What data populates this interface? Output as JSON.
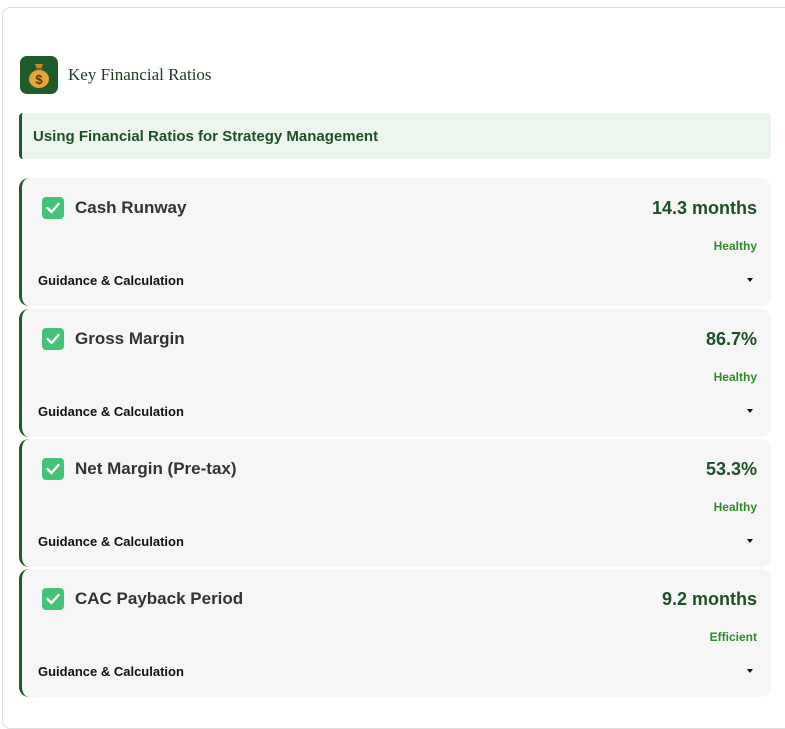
{
  "header": {
    "title": "Key Financial Ratios",
    "icon": "money-bag-icon"
  },
  "banner": {
    "text": "Using Financial Ratios for Strategy Management"
  },
  "colors": {
    "accent": "#1f5b2b",
    "check": "#43c27a",
    "status": "#2f8a2f",
    "card_bg": "#f6f6f6"
  },
  "ratios": [
    {
      "title": "Cash Runway",
      "value": "14.3 months",
      "status": "Healthy",
      "guidance": "Guidance & Calculation"
    },
    {
      "title": "Gross Margin",
      "value": "86.7%",
      "status": "Healthy",
      "guidance": "Guidance & Calculation"
    },
    {
      "title": "Net Margin (Pre-tax)",
      "value": "53.3%",
      "status": "Healthy",
      "guidance": "Guidance & Calculation"
    },
    {
      "title": "CAC Payback Period",
      "value": "9.2 months",
      "status": "Efficient",
      "guidance": "Guidance & Calculation"
    }
  ]
}
